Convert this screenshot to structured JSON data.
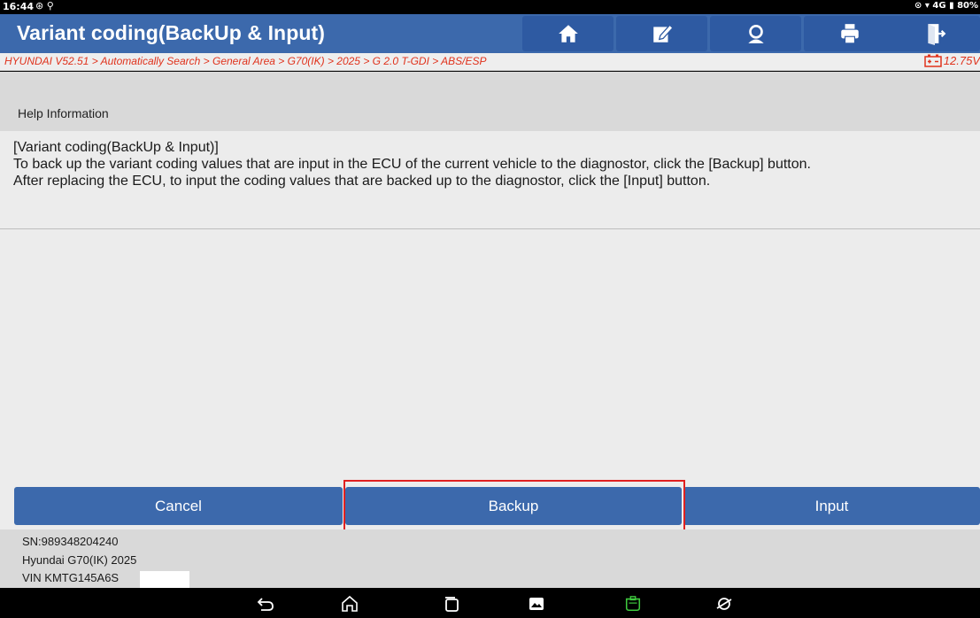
{
  "status_bar": {
    "time": "16:44",
    "battery": "80%",
    "network": "4G"
  },
  "title_bar": {
    "title": "Variant coding(BackUp & Input)",
    "buttons": [
      {
        "name": "home",
        "icon": "home-icon"
      },
      {
        "name": "report",
        "icon": "edit-report-icon"
      },
      {
        "name": "support",
        "icon": "user-support-icon"
      },
      {
        "name": "print",
        "icon": "printer-icon"
      },
      {
        "name": "exit",
        "icon": "exit-icon"
      }
    ]
  },
  "breadcrumb": {
    "path": "HYUNDAI V52.51 > Automatically Search > General Area > G70(IK) > 2025 > G 2.0 T-GDI > ABS/ESP",
    "voltage": "12.75V"
  },
  "help": {
    "header": "Help Information",
    "lines": [
      "[Variant coding(BackUp & Input)]",
      "To back up the variant coding values that are input in the ECU of the current vehicle to the diagnostor, click the [Backup] button.",
      "After replacing the ECU, to input the coding values that are backed up to the diagnostor, click the [Input] button."
    ]
  },
  "actions": {
    "cancel": "Cancel",
    "backup": "Backup",
    "input": "Input"
  },
  "vehicle_info": {
    "sn": "SN:989348204240",
    "model": "Hyundai G70(IK) 2025",
    "vin": "VIN KMTG145A6S"
  },
  "colors": {
    "header_blue": "#3c69ac",
    "breadcrumb_red": "#e0321c",
    "highlight_red": "#e02020"
  }
}
